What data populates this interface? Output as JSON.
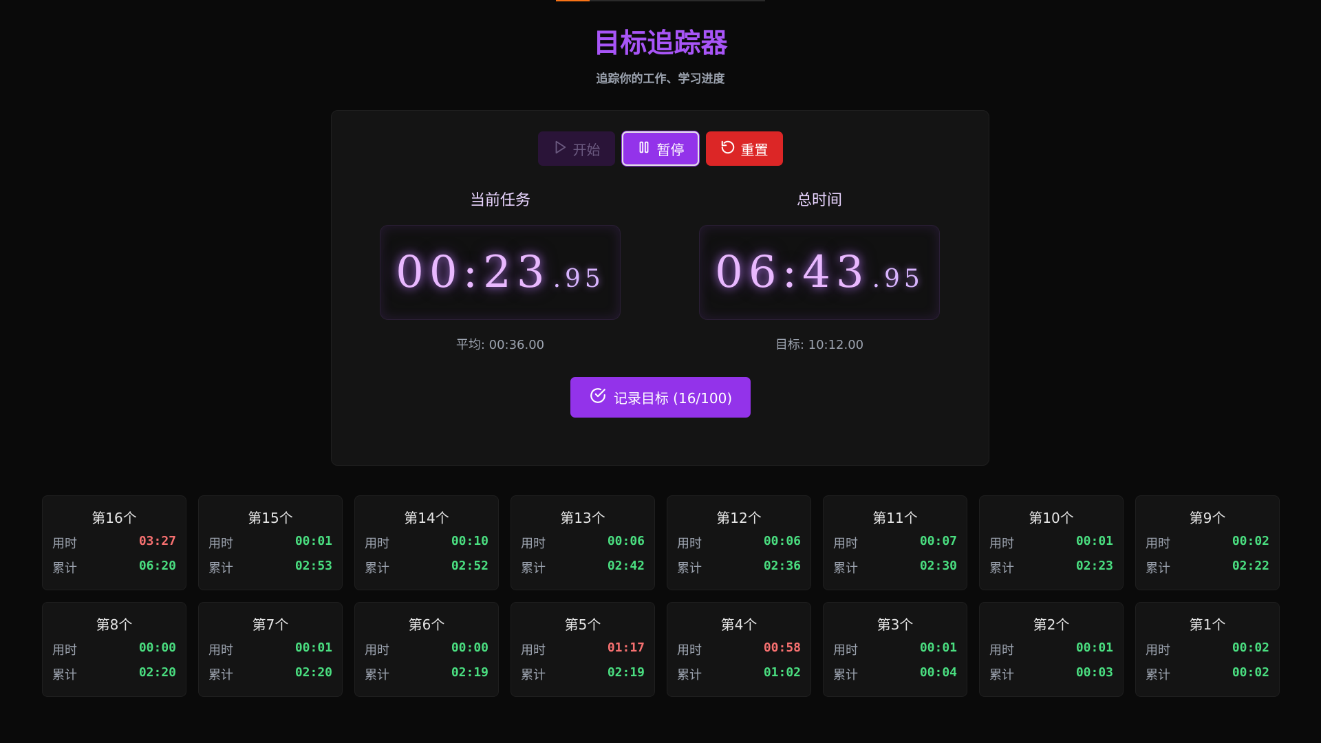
{
  "app": {
    "title": "目标追踪器",
    "subtitle": "追踪你的工作、学习进度",
    "progress_fraction": 0.16
  },
  "controls": {
    "start_label": "开始",
    "pause_label": "暂停",
    "reset_label": "重置"
  },
  "timers": {
    "current": {
      "label": "当前任务",
      "main": "00:23",
      "ms": ".95",
      "sub": "平均: 00:36.00"
    },
    "total": {
      "label": "总时间",
      "main": "06:43",
      "ms": ".95",
      "sub": "目标: 10:12.00"
    }
  },
  "record": {
    "label": "记录目标 (16/100)"
  },
  "labels": {
    "elapsed": "用时",
    "cumulative": "累计"
  },
  "entries": [
    {
      "title": "第16个",
      "elapsed": "03:27",
      "cumulative": "06:20",
      "slow": true
    },
    {
      "title": "第15个",
      "elapsed": "00:01",
      "cumulative": "02:53",
      "slow": false
    },
    {
      "title": "第14个",
      "elapsed": "00:10",
      "cumulative": "02:52",
      "slow": false
    },
    {
      "title": "第13个",
      "elapsed": "00:06",
      "cumulative": "02:42",
      "slow": false
    },
    {
      "title": "第12个",
      "elapsed": "00:06",
      "cumulative": "02:36",
      "slow": false
    },
    {
      "title": "第11个",
      "elapsed": "00:07",
      "cumulative": "02:30",
      "slow": false
    },
    {
      "title": "第10个",
      "elapsed": "00:01",
      "cumulative": "02:23",
      "slow": false
    },
    {
      "title": "第9个",
      "elapsed": "00:02",
      "cumulative": "02:22",
      "slow": false
    },
    {
      "title": "第8个",
      "elapsed": "00:00",
      "cumulative": "02:20",
      "slow": false
    },
    {
      "title": "第7个",
      "elapsed": "00:01",
      "cumulative": "02:20",
      "slow": false
    },
    {
      "title": "第6个",
      "elapsed": "00:00",
      "cumulative": "02:19",
      "slow": false
    },
    {
      "title": "第5个",
      "elapsed": "01:17",
      "cumulative": "02:19",
      "slow": true
    },
    {
      "title": "第4个",
      "elapsed": "00:58",
      "cumulative": "01:02",
      "slow": true
    },
    {
      "title": "第3个",
      "elapsed": "00:01",
      "cumulative": "00:04",
      "slow": false
    },
    {
      "title": "第2个",
      "elapsed": "00:01",
      "cumulative": "00:03",
      "slow": false
    },
    {
      "title": "第1个",
      "elapsed": "00:02",
      "cumulative": "00:02",
      "slow": false
    }
  ],
  "colors": {
    "accent": "#a855f7",
    "button_purple": "#9333ea",
    "danger": "#dc2626",
    "ok": "#4ade80",
    "slow": "#f87171"
  },
  "icons": {
    "start": "play-icon",
    "pause": "pause-icon",
    "reset": "rotate-ccw-icon",
    "record": "check-circle-icon"
  }
}
